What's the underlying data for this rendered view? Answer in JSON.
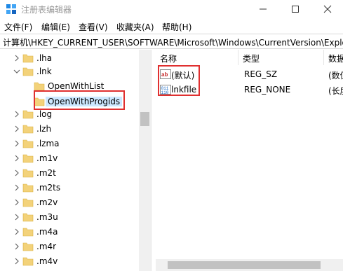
{
  "window": {
    "title": "注册表编辑器",
    "controls": {
      "minimize": "minimize",
      "maximize": "maximize",
      "close": "close"
    }
  },
  "menu": [
    "文件(F)",
    "编辑(E)",
    "查看(V)",
    "收藏夹(A)",
    "帮助(H)"
  ],
  "address": "计算机\\HKEY_CURRENT_USER\\SOFTWARE\\Microsoft\\Windows\\CurrentVersion\\Explo",
  "tree": {
    "items": [
      {
        "label": ".lha",
        "expanded": false,
        "level": 1
      },
      {
        "label": ".lnk",
        "expanded": true,
        "level": 1
      },
      {
        "label": "OpenWithList",
        "level": 2
      },
      {
        "label": "OpenWithProgids",
        "level": 2,
        "selected": true
      },
      {
        "label": ".log",
        "level": 1
      },
      {
        "label": ".lzh",
        "level": 1
      },
      {
        "label": ".lzma",
        "level": 1
      },
      {
        "label": ".m1v",
        "level": 1
      },
      {
        "label": ".m2t",
        "level": 1
      },
      {
        "label": ".m2ts",
        "level": 1
      },
      {
        "label": ".m2v",
        "level": 1
      },
      {
        "label": ".m3u",
        "level": 1
      },
      {
        "label": ".m4a",
        "level": 1
      },
      {
        "label": ".m4r",
        "level": 1
      },
      {
        "label": ".m4v",
        "level": 1
      }
    ]
  },
  "list": {
    "columns": [
      "名称",
      "类型",
      "数据"
    ],
    "rows": [
      {
        "name": "(默认)",
        "type": "REG_SZ",
        "data": "(数值",
        "icon": "string-value-icon"
      },
      {
        "name": "lnkfile",
        "type": "REG_NONE",
        "data": "(长度",
        "icon": "binary-value-icon"
      }
    ]
  },
  "colors": {
    "highlight_box": "#e03030",
    "selection": "#cce8ff",
    "folder": "#f3d27a"
  }
}
